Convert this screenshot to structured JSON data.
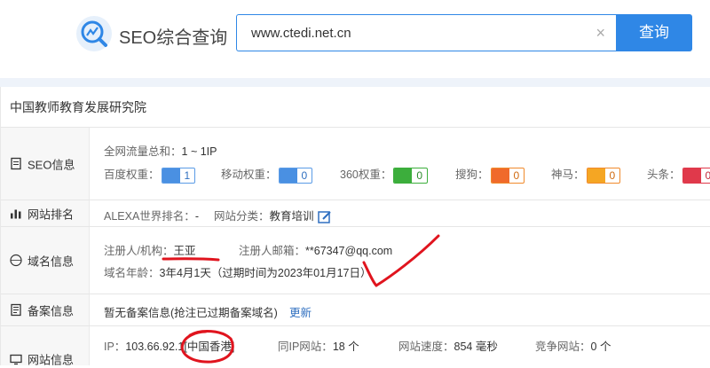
{
  "header": {
    "brand": "SEO综合查询",
    "search_value": "www.ctedi.net.cn",
    "clear_symbol": "×",
    "search_button": "查询"
  },
  "site_name": "中国教师教育发展研究院",
  "seo": {
    "label": "SEO信息",
    "traffic_label": "全网流量总和：",
    "traffic_value": "1 ~ 1IP",
    "baidu_label": "百度权重：",
    "baidu_value": "1",
    "mobile_label": "移动权重：",
    "mobile_value": "0",
    "s360_label": "360权重：",
    "s360_value": "0",
    "sogou_label": "搜狗：",
    "sogou_value": "0",
    "shenma_label": "神马：",
    "shenma_value": "0",
    "toutiao_label": "头条：",
    "toutiao_value": "0"
  },
  "rank": {
    "label": "网站排名",
    "alexa_label": "ALEXA世界排名：",
    "alexa_value": "-",
    "category_label": "网站分类：",
    "category_value": "教育培训"
  },
  "domain": {
    "label": "域名信息",
    "registrant_label": "注册人/机构：",
    "registrant_value": "王亚",
    "email_label": "注册人邮箱：",
    "email_value": "**67347@qq.com",
    "age_label": "域名年龄：",
    "age_value": "3年4月1天（过期时间为2023年01月17日）"
  },
  "beian": {
    "label": "备案信息",
    "text": "暂无备案信息(抢注已过期备案域名)",
    "update_link": "更新"
  },
  "siteinfo": {
    "label": "网站信息",
    "ip_label": "IP：",
    "ip_value": "103.66.92.1",
    "ip_location": "[中国香港]",
    "same_ip_label": "同IP网站：",
    "same_ip_value": "18 个",
    "speed_label": "网站速度：",
    "speed_value": "854 毫秒",
    "competitor_label": "竞争网站：",
    "competitor_value": "0 个"
  },
  "colors": {
    "accent": "#2f87e6",
    "annotation_red": "#e0141e"
  }
}
